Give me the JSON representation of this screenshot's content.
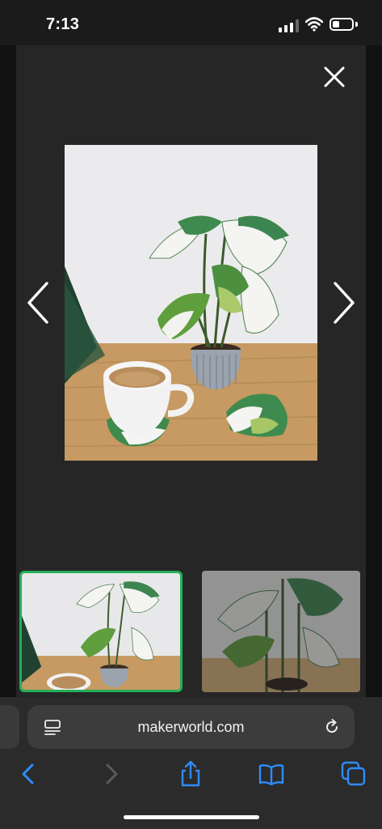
{
  "status": {
    "time": "7:13",
    "icons": [
      "signal-icon",
      "wifi-icon",
      "battery-icon"
    ]
  },
  "viewer": {
    "close_icon": "close-icon",
    "prev_icon": "chevron-left-icon",
    "next_icon": "chevron-right-icon",
    "image_description_icon": "photo",
    "thumbnails": [
      {
        "selected": true
      },
      {
        "selected": false
      }
    ]
  },
  "browser": {
    "url": "makerworld.com",
    "toolbar": [
      "back-icon",
      "forward-icon",
      "share-icon",
      "bookmarks-icon",
      "tabs-icon"
    ]
  },
  "colors": {
    "accent": "#2f8cff",
    "selected_border": "#22b05a",
    "background": "#262626"
  }
}
